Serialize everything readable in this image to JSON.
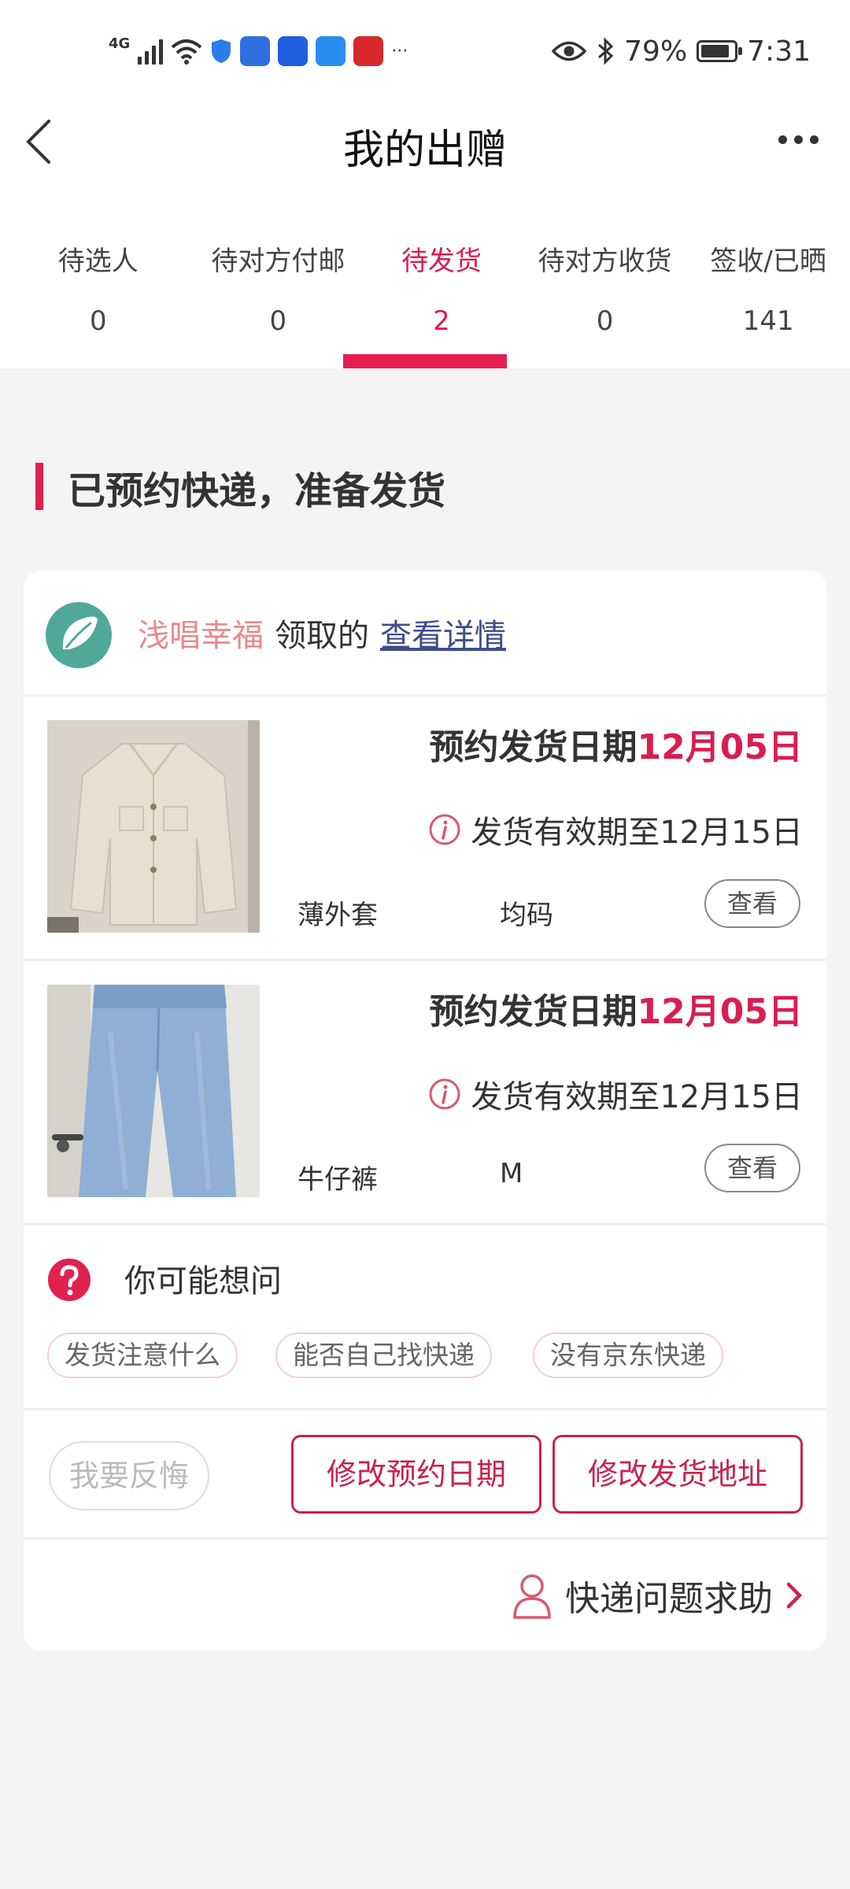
{
  "status_bar": {
    "network": "4G",
    "battery": "79%",
    "time": "7:31",
    "more": "···"
  },
  "header": {
    "title": "我的出赠",
    "back_icon": "back-chevron-icon",
    "more_icon": "more-dots-icon"
  },
  "tabs": [
    {
      "label": "待选人",
      "count": "0"
    },
    {
      "label": "待对方付邮",
      "count": "0"
    },
    {
      "label": "待发货",
      "count": "2",
      "active": true
    },
    {
      "label": "待对方收货",
      "count": "0"
    },
    {
      "label": "签收/已晒",
      "count": "141"
    }
  ],
  "section": {
    "title": "已预约快递，准备发货"
  },
  "recipient": {
    "name": "浅唱幸福",
    "suffix": "领取的",
    "detail_link": "查看详情"
  },
  "items": [
    {
      "ship_label": "预约发货日期",
      "ship_date": "12月05日",
      "valid_until": "发货有效期至12月15日",
      "name": "薄外套",
      "size": "均码",
      "view_label": "查看"
    },
    {
      "ship_label": "预约发货日期",
      "ship_date": "12月05日",
      "valid_until": "发货有效期至12月15日",
      "name": "牛仔裤",
      "size": "M",
      "view_label": "查看"
    }
  ],
  "faq": {
    "title": "你可能想问",
    "chips": [
      "发货注意什么",
      "能否自己找快递",
      "没有京东快递"
    ]
  },
  "actions": {
    "regret": "我要反悔",
    "change_date": "修改预约日期",
    "change_address": "修改发货地址"
  },
  "help": {
    "label": "快递问题求助"
  },
  "colors": {
    "accent": "#d81e4f",
    "link": "#3d4d8c",
    "name": "#e88a8a"
  }
}
